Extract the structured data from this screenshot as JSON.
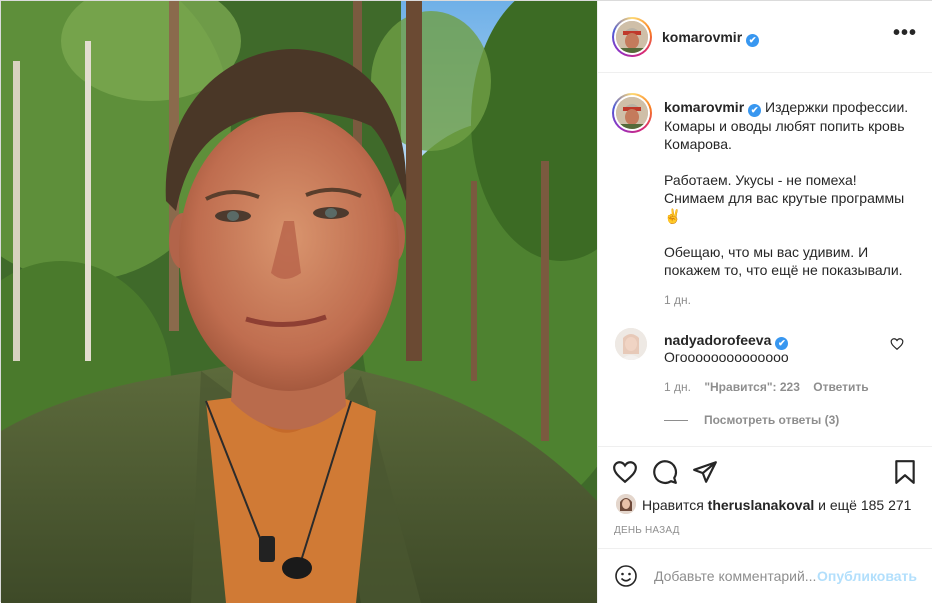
{
  "post": {
    "author": "komarovmir",
    "verified_mark": "✔",
    "more_icon": "•••",
    "caption": {
      "line1": "Издержки профессии. Комары и оводы любят попить кровь Комарова.",
      "line2": "Работаем. Укусы - не помеха! Снимаем для вас крутые программы ✌",
      "line3": "Обещаю, что мы вас удивим. И покажем то, что ещё не показывали."
    },
    "caption_time": "1 дн."
  },
  "comment": {
    "user": "nadyadorofeeva",
    "text": "Огоооооооооооооо",
    "time": "1 дн.",
    "likes": "\"Нравится\": 223",
    "reply_label": "Ответить",
    "view_replies": "Посмотреть ответы (3)"
  },
  "likes": {
    "prefix": "Нравится",
    "user": "theruslanakoval",
    "suffix": "и ещё 185 271"
  },
  "date_label": "День назад",
  "add_comment": {
    "placeholder": "Добавьте комментарий...",
    "publish_label": "Опубликовать"
  },
  "colors": {
    "accent": "#3897f0",
    "publish_disabled": "#b2dffc",
    "muted": "#8e8e8e",
    "text": "#262626"
  },
  "icons": [
    "more-icon",
    "heart-icon",
    "comment-icon",
    "share-icon",
    "bookmark-icon",
    "emoji-icon",
    "verified-icon"
  ]
}
